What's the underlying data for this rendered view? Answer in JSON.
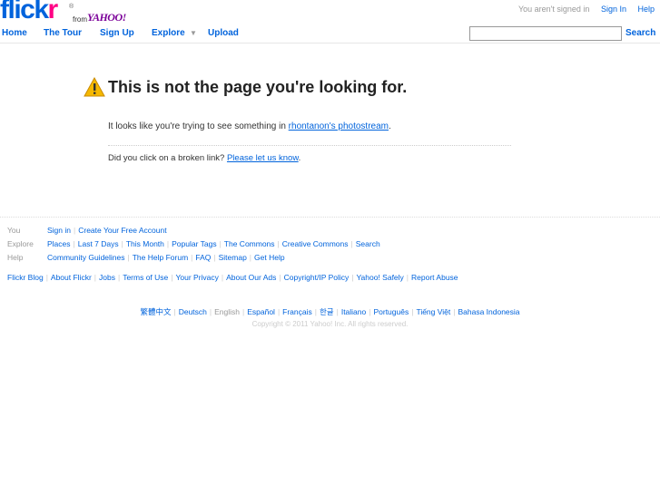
{
  "brand": {
    "flick": "flick",
    "r": "r",
    "reg": "®",
    "from": "from",
    "yahoo": "YAHOO!"
  },
  "top": {
    "status": "You aren't signed in",
    "sign_in": "Sign In",
    "help": "Help"
  },
  "nav": {
    "home": "Home",
    "tour": "The Tour",
    "signup": "Sign Up",
    "explore": "Explore",
    "upload": "Upload",
    "search_value": "",
    "search_btn": "Search"
  },
  "main": {
    "title": "This is not the page you're looking for.",
    "msg_prefix": "It looks like you're trying to see something in ",
    "photostream_link": "rhontanon's photostream",
    "msg_suffix": ".",
    "broken_prefix": "Did you click on a broken link? ",
    "broken_link": "Please let us know",
    "broken_suffix": "."
  },
  "footer": {
    "you_label": "You",
    "you_links": [
      "Sign in",
      "Create Your Free Account"
    ],
    "explore_label": "Explore",
    "explore_links": [
      "Places",
      "Last 7 Days",
      "This Month",
      "Popular Tags",
      "The Commons",
      "Creative Commons",
      "Search"
    ],
    "help_label": "Help",
    "help_links": [
      "Community Guidelines",
      "The Help Forum",
      "FAQ",
      "Sitemap",
      "Get Help"
    ],
    "misc_links": [
      "Flickr Blog",
      "About Flickr",
      "Jobs",
      "Terms of Use",
      "Your Privacy",
      "About Our Ads",
      "Copyright/IP Policy",
      "Yahoo! Safely",
      "Report Abuse"
    ],
    "languages": [
      "繁體中文",
      "Deutsch",
      "English",
      "Español",
      "Français",
      "한글",
      "Italiano",
      "Português",
      "Tiếng Việt",
      "Bahasa Indonesia"
    ],
    "current_language": "English",
    "copyright": "Copyright © 2011 Yahoo! Inc. All rights reserved."
  },
  "colors": {
    "link": "#0063dc",
    "pink": "#ff0084",
    "yahoo": "#7b0099",
    "warning": "#f5b800"
  }
}
